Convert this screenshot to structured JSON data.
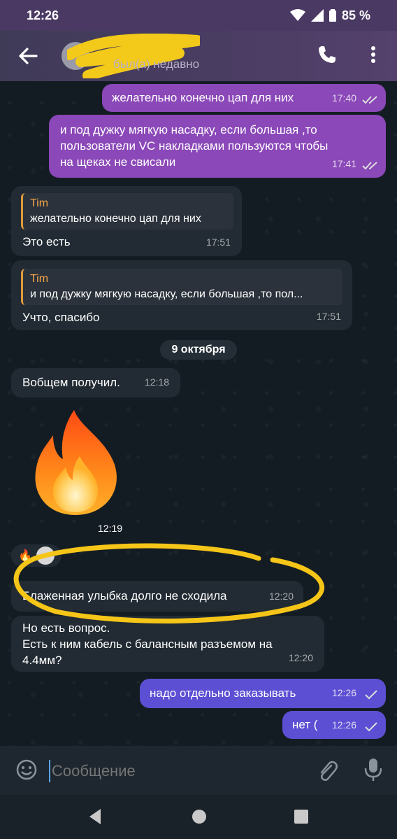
{
  "status_bar": {
    "time": "12:26",
    "battery": "85 %"
  },
  "header": {
    "contact_status": "был(а) недавно"
  },
  "messages": [
    {
      "text": "желательно конечно цап для них",
      "time": "17:40"
    },
    {
      "text": "и под дужку мягкую насадку, если большая ,то пользователи VC накладками пользуются чтобы на щеках не свисали",
      "time": "17:41"
    },
    {
      "quote_author": "Tim",
      "quote_text": "желательно конечно цап для них",
      "text": "Это есть",
      "time": "17:51"
    },
    {
      "quote_author": "Tim",
      "quote_text": "и под дужку мягкую насадку, если большая ,то пол...",
      "text": "Учто, спасибо",
      "time": "17:51"
    },
    {
      "text": "Вобщем получил.",
      "time": "12:18"
    },
    {
      "sticker": "fire-emoji",
      "time": "12:19"
    },
    {
      "reaction": "🔥"
    },
    {
      "text": "Блаженная улыбка долго не сходила",
      "time": "12:20"
    },
    {
      "text": "Но есть вопрос.\nЕсть к ним кабель с балансным разъемом на 4.4мм?",
      "time": "12:20"
    },
    {
      "text": "надо отдельно заказывать",
      "time": "12:26"
    },
    {
      "text": "нет (",
      "time": "12:26"
    }
  ],
  "date_separator": "9 октября",
  "input": {
    "placeholder": "Сообщение"
  },
  "colors": {
    "outgoing": "#8b48b8",
    "outgoing_recent": "#5d4fd3",
    "incoming": "#222b33",
    "header": "#4b3d63",
    "quote_accent": "#f2a548"
  }
}
